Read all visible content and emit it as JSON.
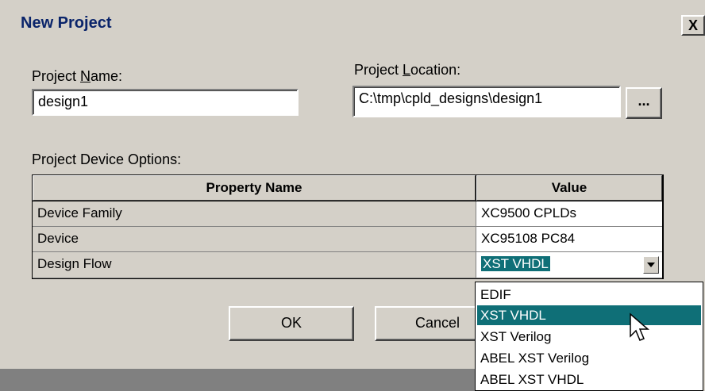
{
  "dialog": {
    "title": "New Project",
    "close_glyph": "X"
  },
  "project_name": {
    "label_pre": "Project ",
    "label_accel": "N",
    "label_post": "ame:",
    "value": "design1"
  },
  "project_location": {
    "label_pre": "Project ",
    "label_accel": "L",
    "label_post": "ocation:",
    "value": "C:\\tmp\\cpld_designs\\design1",
    "browse_label": "..."
  },
  "device_options": {
    "label": "Project Device Options:",
    "headers": {
      "name": "Property Name",
      "value": "Value"
    },
    "rows": [
      {
        "name": "Device Family",
        "value": "XC9500 CPLDs"
      },
      {
        "name": "Device",
        "value": "XC95108 PC84"
      },
      {
        "name": "Design Flow",
        "value": "XST VHDL"
      }
    ]
  },
  "design_flow_dropdown": {
    "options": [
      "EDIF",
      "XST VHDL",
      "XST Verilog",
      "ABEL XST Verilog",
      "ABEL XST VHDL"
    ],
    "selected": "XST VHDL"
  },
  "buttons": {
    "ok": "OK",
    "cancel": "Cancel"
  },
  "colors": {
    "highlight": "#0f6f77",
    "title_text": "#0a246a",
    "face": "#d4d0c8"
  }
}
